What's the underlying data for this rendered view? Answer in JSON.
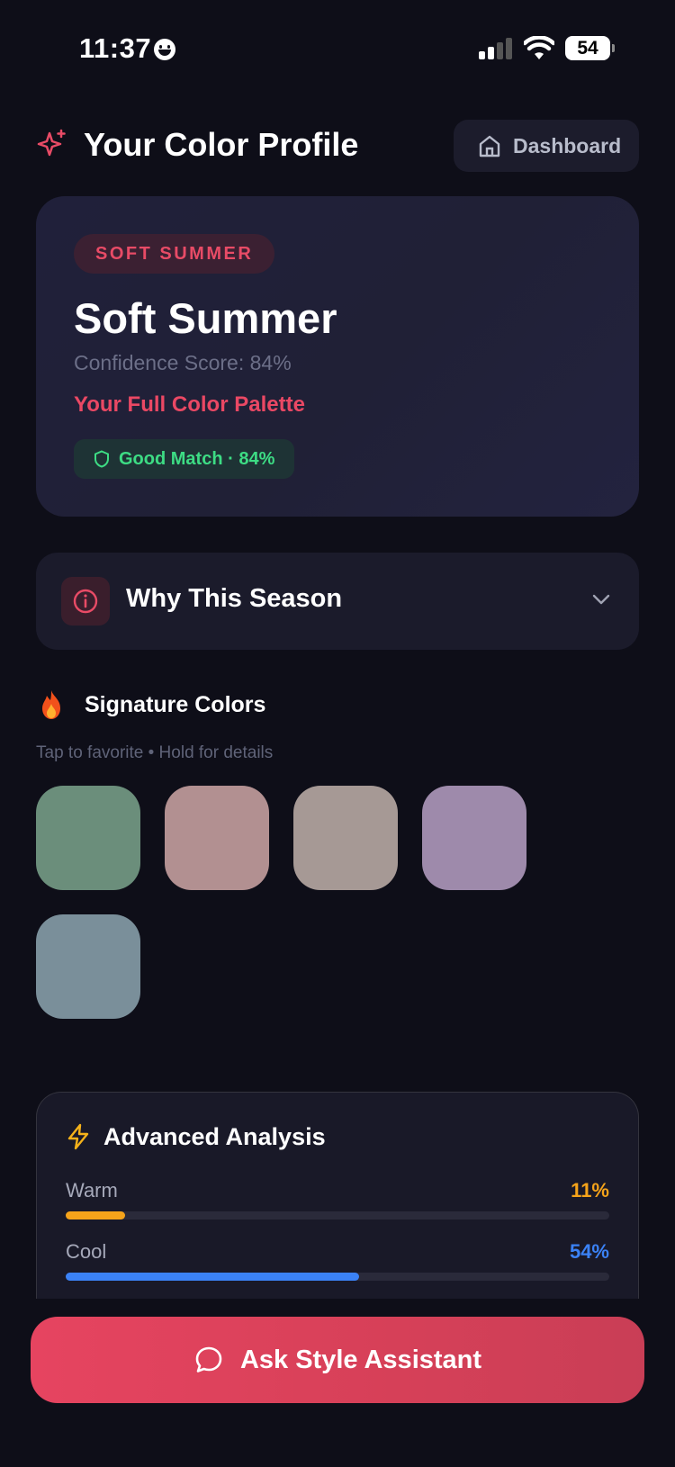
{
  "status_bar": {
    "time": "11:37",
    "battery": "54"
  },
  "header": {
    "title": "Your Color Profile",
    "dashboard_label": "Dashboard"
  },
  "profile": {
    "badge": "SOFT SUMMER",
    "season": "Soft Summer",
    "confidence_text": "Confidence Score: 84%",
    "palette_link": "Your Full Color Palette",
    "match_badge": "Good Match · 84%"
  },
  "why": {
    "title": "Why This Season"
  },
  "signature": {
    "title": "Signature Colors",
    "hint": "Tap to favorite • Hold for details",
    "colors": [
      "#6b8e7b",
      "#b29091",
      "#a69995",
      "#9e8aab",
      "#7a8f9a"
    ]
  },
  "analysis": {
    "title": "Advanced Analysis",
    "bars": [
      {
        "label": "Warm",
        "value_text": "11%",
        "value": 11,
        "color": "#f5a31a"
      },
      {
        "label": "Cool",
        "value_text": "54%",
        "value": 54,
        "color": "#3b82f6"
      }
    ]
  },
  "cta": {
    "label": "Ask Style Assistant"
  },
  "colors": {
    "accent": "#e84b66",
    "success": "#3ddc84",
    "background": "#0e0e18"
  }
}
